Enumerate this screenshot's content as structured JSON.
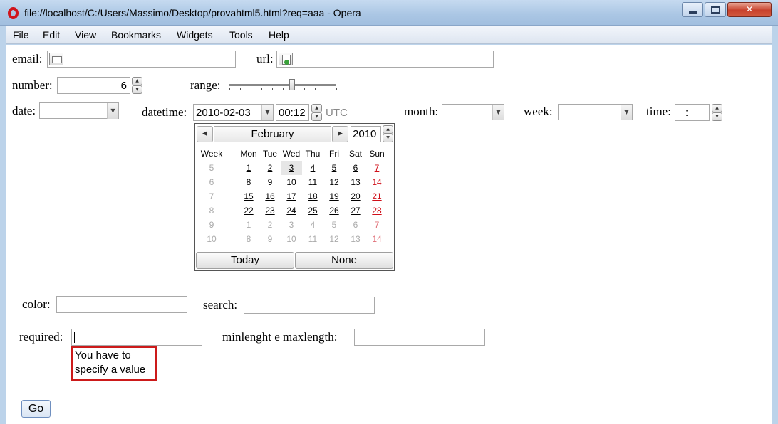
{
  "window": {
    "title": "file://localhost/C:/Users/Massimo/Desktop/provahtml5.html?req=aaa - Opera",
    "close_glyph": "✕"
  },
  "menu": [
    "File",
    "Edit",
    "View",
    "Bookmarks",
    "Widgets",
    "Tools",
    "Help"
  ],
  "form": {
    "email_label": "email:",
    "url_label": "url:",
    "number_label": "number:",
    "number_value": "6",
    "range_label": "range:",
    "range_value": 0.6,
    "date_label": "date:",
    "datetime_label": "datetime:",
    "datetime_date": "2010-02-03",
    "datetime_time": "00:12",
    "datetime_tz": "UTC",
    "month_label": "month:",
    "week_label": "week:",
    "time_label": "time:",
    "time_value": ":",
    "color_label": "color:",
    "search_label": "search:",
    "required_label": "required:",
    "minmax_label": "minlenght e maxlength:",
    "error_message": "You have to specify a value",
    "go_label": "Go"
  },
  "calendar": {
    "month": "February",
    "year": "2010",
    "prev_glyph": "◀",
    "next_glyph": "▶",
    "headers": [
      "Week",
      "Mon",
      "Tue",
      "Wed",
      "Thu",
      "Fri",
      "Sat",
      "Sun"
    ],
    "weeks": [
      "5",
      "6",
      "7",
      "8",
      "9",
      "10"
    ],
    "rows": [
      [
        "1",
        "2",
        "3",
        "4",
        "5",
        "6",
        "7"
      ],
      [
        "8",
        "9",
        "10",
        "11",
        "12",
        "13",
        "14"
      ],
      [
        "15",
        "16",
        "17",
        "18",
        "19",
        "20",
        "21"
      ],
      [
        "22",
        "23",
        "24",
        "25",
        "26",
        "27",
        "28"
      ],
      [
        "1",
        "2",
        "3",
        "4",
        "5",
        "6",
        "7"
      ],
      [
        "8",
        "9",
        "10",
        "11",
        "12",
        "13",
        "14"
      ]
    ],
    "selected_day": "3",
    "today_label": "Today",
    "none_label": "None"
  }
}
